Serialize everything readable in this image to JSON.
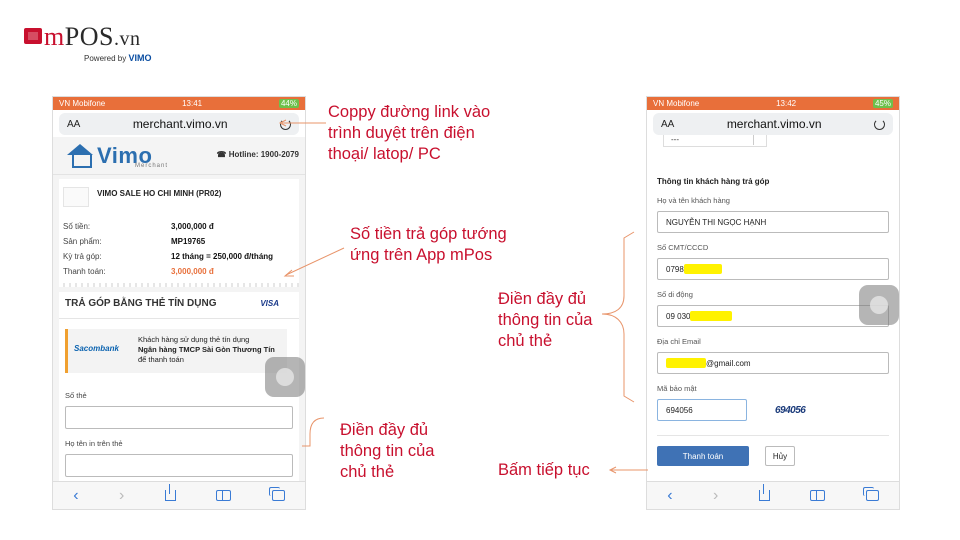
{
  "logo": {
    "brand_m": "m",
    "brand_rest": "POS",
    "brand_tld": ".vn",
    "powered": "Powered by",
    "powered_brand": "VIMO"
  },
  "left_phone": {
    "status": {
      "carrier": "VN Mobifone",
      "time": "13:41",
      "battery": "44%"
    },
    "url": {
      "aa": "AA",
      "address": "merchant.vimo.vn"
    },
    "header": {
      "brand": "Vimo",
      "sub": "Merchant",
      "hotline": "Hotline: 1900-2079"
    },
    "merchant_name": "VIMO SALE HO CHI MINH (PR02)",
    "info": [
      {
        "k": "Số tiền:",
        "v": "3,000,000 đ"
      },
      {
        "k": "Sản phẩm:",
        "v": "MP19765"
      },
      {
        "k": "Kỳ trả góp:",
        "v": "12 tháng = 250,000 đ/tháng"
      },
      {
        "k": "Thanh toán:",
        "v": "3,000,000 đ"
      }
    ],
    "section_title": "TRẢ GÓP BẰNG THẺ TÍN DỤNG",
    "visa": "VISA",
    "bank_logo": "Sacombank",
    "bank_line1": "Khách hàng sử dụng thẻ tín dụng",
    "bank_line2": "Ngân hàng TMCP Sài Gòn Thương Tín",
    "bank_line3": "để thanh toán",
    "card_number_label": "Số thẻ",
    "card_name_label": "Họ tên in trên thẻ"
  },
  "right_phone": {
    "status": {
      "carrier": "VN Mobifone",
      "time": "13:42",
      "battery": "45%"
    },
    "url": {
      "aa": "AA",
      "address": "merchant.vimo.vn"
    },
    "select_partial": "---",
    "section_title": "Thông tin khách hàng trả góp",
    "fields": {
      "name_label": "Họ và tên khách hàng",
      "name_value": "NGUYỄN THI NGỌC HẠNH",
      "id_label": "Số CMT/CCCD",
      "id_value": "0798",
      "phone_label": "Số di động",
      "phone_value": "09 030",
      "email_label": "Địa chỉ Email",
      "email_value": "@gmail.com",
      "captcha_label": "Mã bảo mật",
      "captcha_value": "694056",
      "captcha_image_text": "694056"
    },
    "pay_button": "Thanh toán",
    "cancel_button": "Hủy"
  },
  "annotations": {
    "copy_link": [
      "Coppy đường link vào",
      "trình duyệt trên điện",
      "thoại/ latop/ PC"
    ],
    "installment": [
      "Số tiền trả góp tướng",
      "ứng trên App mPos"
    ],
    "fill_left": [
      "Điền đầy đủ",
      "thông tin của",
      "chủ thẻ"
    ],
    "fill_right": [
      "Điền đầy đủ",
      "thông tin của",
      "chủ thẻ"
    ],
    "continue": "Bấm tiếp tục"
  },
  "colors": {
    "accent_red": "#c8102e",
    "status_orange": "#e86f3a",
    "vimo_blue": "#2c6fb0",
    "button_blue": "#3f72b5",
    "highlight": "#fff200"
  }
}
